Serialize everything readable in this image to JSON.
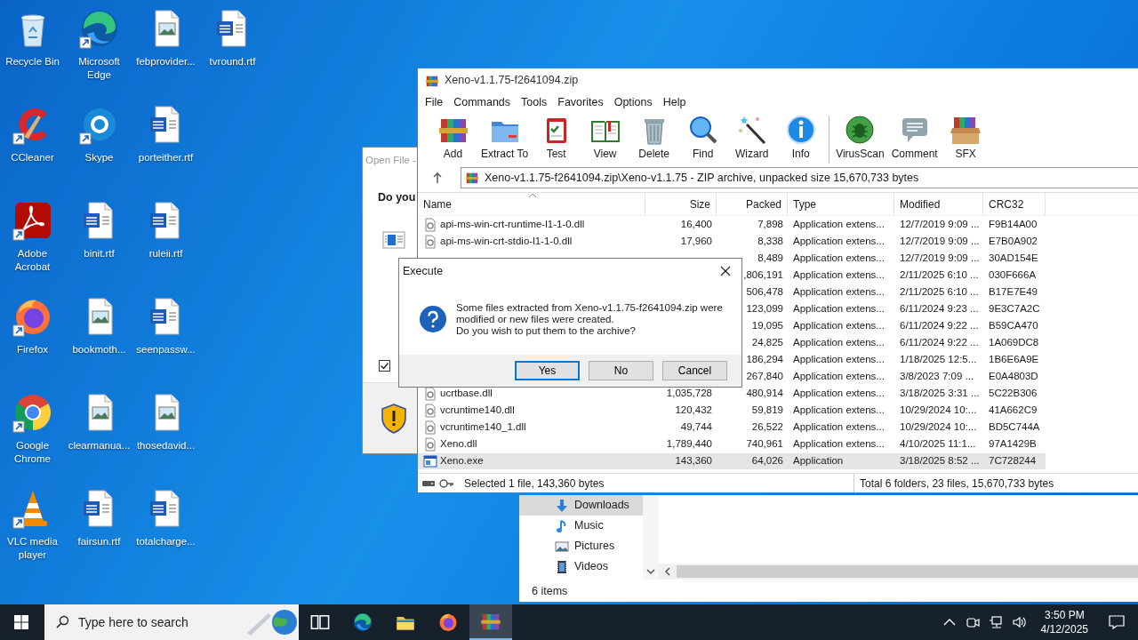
{
  "desktop": {
    "columns": [
      [
        {
          "label": "Recycle Bin",
          "kind": "recycle",
          "shortcut": false
        },
        {
          "label": "CCleaner",
          "kind": "ccleaner",
          "shortcut": true
        },
        {
          "label": "Adobe Acrobat",
          "kind": "acrobat",
          "shortcut": true
        },
        {
          "label": "Firefox",
          "kind": "firefox",
          "shortcut": true
        },
        {
          "label": "Google Chrome",
          "kind": "chrome",
          "shortcut": true
        },
        {
          "label": "VLC media player",
          "kind": "vlc",
          "shortcut": true
        }
      ],
      [
        {
          "label": "Microsoft Edge",
          "kind": "edge",
          "shortcut": true
        },
        {
          "label": "Skype",
          "kind": "skype",
          "shortcut": true
        },
        {
          "label": "binit.rtf",
          "kind": "rtf",
          "shortcut": false
        },
        {
          "label": "bookmoth...",
          "kind": "image",
          "shortcut": false
        },
        {
          "label": "clearmanua...",
          "kind": "image",
          "shortcut": false
        },
        {
          "label": "fairsun.rtf",
          "kind": "rtf",
          "shortcut": false
        }
      ],
      [
        {
          "label": "febprovider...",
          "kind": "image",
          "shortcut": false
        },
        {
          "label": "porteither.rtf",
          "kind": "rtf",
          "shortcut": false
        },
        {
          "label": "ruleii.rtf",
          "kind": "rtf",
          "shortcut": false
        },
        {
          "label": "seenpassw...",
          "kind": "rtf",
          "shortcut": false
        },
        {
          "label": "thosedavid...",
          "kind": "image",
          "shortcut": false
        },
        {
          "label": "totalcharge...",
          "kind": "rtf",
          "shortcut": false
        }
      ],
      [
        {
          "label": "tvround.rtf",
          "kind": "rtf",
          "shortcut": false
        }
      ]
    ]
  },
  "open_file_window": {
    "title": "Open File -",
    "question": "Do you",
    "checkbox": {
      "checked": true
    }
  },
  "explorer": {
    "nav": [
      {
        "label": "Downloads",
        "kind": "downloads",
        "selected": true
      },
      {
        "label": "Music",
        "kind": "music",
        "selected": false
      },
      {
        "label": "Pictures",
        "kind": "pictures",
        "selected": false
      },
      {
        "label": "Videos",
        "kind": "videos",
        "selected": false
      }
    ],
    "status": "6 items"
  },
  "winrar": {
    "title": "Xeno-v1.1.75-f2641094.zip",
    "menu": [
      "File",
      "Commands",
      "Tools",
      "Favorites",
      "Options",
      "Help"
    ],
    "toolbar": [
      [
        {
          "label": "Add",
          "kind": "add"
        },
        {
          "label": "Extract To",
          "kind": "extract"
        },
        {
          "label": "Test",
          "kind": "test"
        },
        {
          "label": "View",
          "kind": "view"
        },
        {
          "label": "Delete",
          "kind": "delete"
        },
        {
          "label": "Find",
          "kind": "find"
        },
        {
          "label": "Wizard",
          "kind": "wizard"
        },
        {
          "label": "Info",
          "kind": "info"
        }
      ],
      [
        {
          "label": "VirusScan",
          "kind": "virusscan"
        },
        {
          "label": "Comment",
          "kind": "comment"
        },
        {
          "label": "SFX",
          "kind": "sfx"
        }
      ]
    ],
    "address": "Xeno-v1.1.75-f2641094.zip\\Xeno-v1.1.75 - ZIP archive, unpacked size 15,670,733 bytes",
    "columns": [
      "Name",
      "Size",
      "Packed",
      "Type",
      "Modified",
      "CRC32"
    ],
    "rows": [
      {
        "kind": "dll",
        "name": "api-ms-win-crt-runtime-l1-1-0.dll",
        "size": "16,400",
        "packed": "7,898",
        "type": "Application extens...",
        "modified": "12/7/2019 9:09 ...",
        "crc32": "F9B14A00",
        "selected": false
      },
      {
        "kind": "dll",
        "name": "api-ms-win-crt-stdio-l1-1-0.dll",
        "size": "17,960",
        "packed": "8,338",
        "type": "Application extens...",
        "modified": "12/7/2019 9:09 ...",
        "crc32": "E7B0A902",
        "selected": false
      },
      {
        "packed": "8,489",
        "type": "Application extens...",
        "modified": "12/7/2019 9:09 ...",
        "crc32": "30AD154E",
        "selected": false
      },
      {
        "packed": ",806,191",
        "type": "Application extens...",
        "modified": "2/11/2025 6:10 ...",
        "crc32": "030F666A",
        "selected": false
      },
      {
        "packed": "506,478",
        "type": "Application extens...",
        "modified": "2/11/2025 6:10 ...",
        "crc32": "B17E7E49",
        "selected": false
      },
      {
        "packed": "123,099",
        "type": "Application extens...",
        "modified": "6/11/2024 9:23 ...",
        "crc32": "9E3C7A2C",
        "selected": false
      },
      {
        "packed": "19,095",
        "type": "Application extens...",
        "modified": "6/11/2024 9:22 ...",
        "crc32": "B59CA470",
        "selected": false
      },
      {
        "packed": "24,825",
        "type": "Application extens...",
        "modified": "6/11/2024 9:22 ...",
        "crc32": "1A069DC8",
        "selected": false
      },
      {
        "packed": "186,294",
        "type": "Application extens...",
        "modified": "1/18/2025 12:5...",
        "crc32": "1B6E6A9E",
        "selected": false
      },
      {
        "packed": "267,840",
        "type": "Application extens...",
        "modified": "3/8/2023 7:09 ...",
        "crc32": "E0A4803D",
        "selected": false
      },
      {
        "kind": "dll",
        "name": "ucrtbase.dll",
        "size": "1,035,728",
        "packed": "480,914",
        "type": "Application extens...",
        "modified": "3/18/2025 3:31 ...",
        "crc32": "5C22B306",
        "selected": false
      },
      {
        "kind": "dll",
        "name": "vcruntime140.dll",
        "size": "120,432",
        "packed": "59,819",
        "type": "Application extens...",
        "modified": "10/29/2024 10:...",
        "crc32": "41A662C9",
        "selected": false
      },
      {
        "kind": "dll",
        "name": "vcruntime140_1.dll",
        "size": "49,744",
        "packed": "26,522",
        "type": "Application extens...",
        "modified": "10/29/2024 10:...",
        "crc32": "BD5C744A",
        "selected": false
      },
      {
        "kind": "dll",
        "name": "Xeno.dll",
        "size": "1,789,440",
        "packed": "740,961",
        "type": "Application extens...",
        "modified": "4/10/2025 11:1...",
        "crc32": "97A1429B",
        "selected": false
      },
      {
        "kind": "exe",
        "name": "Xeno.exe",
        "size": "143,360",
        "packed": "64,026",
        "type": "Application",
        "modified": "3/18/2025 8:52 ...",
        "crc32": "7C728244",
        "selected": true
      }
    ],
    "status_left": "Selected 1 file, 143,360 bytes",
    "status_right": "Total 6 folders, 23 files, 15,670,733 bytes"
  },
  "dialog": {
    "title": "Execute",
    "message": "Some files extracted from Xeno-v1.1.75-f2641094.zip were\nmodified or new files were created.\nDo you wish to put them to the archive?",
    "buttons": [
      {
        "label": "Yes",
        "selected": true
      },
      {
        "label": "No",
        "selected": false
      },
      {
        "label": "Cancel",
        "selected": false
      }
    ]
  },
  "taskbar": {
    "search_placeholder": "Type here to search",
    "apps": [
      {
        "kind": "taskview",
        "active": false
      },
      {
        "kind": "edge",
        "active": false
      },
      {
        "kind": "folder",
        "active": false
      },
      {
        "kind": "firefox",
        "active": false
      },
      {
        "kind": "winrar",
        "active": true
      }
    ],
    "time": "3:50 PM",
    "date": "4/12/2025"
  }
}
